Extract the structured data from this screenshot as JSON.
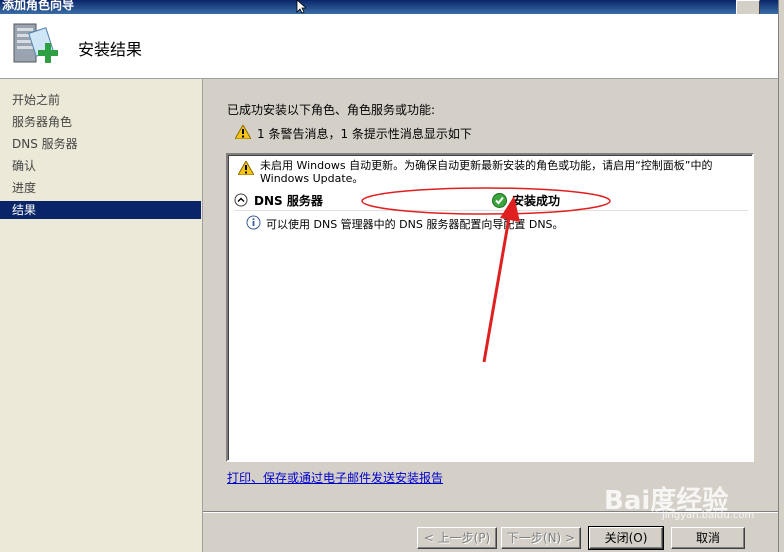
{
  "window": {
    "title": "添加角色向导"
  },
  "header": {
    "title": "安装结果"
  },
  "nav": {
    "items": [
      {
        "label": "开始之前",
        "active": false
      },
      {
        "label": "服务器角色",
        "active": false
      },
      {
        "label": "DNS 服务器",
        "active": false
      },
      {
        "label": "确认",
        "active": false
      },
      {
        "label": "进度",
        "active": false
      },
      {
        "label": "结果",
        "active": true
      }
    ]
  },
  "content": {
    "summary": "已成功安装以下角色、角色服务或功能:",
    "warning_summary": "1 条警告消息，1 条提示性消息显示如下",
    "results": {
      "warning_message": "未启用 Windows 自动更新。为确保自动更新最新安装的角色或功能，请启用“控制面板”中的 Windows Update。",
      "role": {
        "name": "DNS 服务器",
        "status": "安装成功"
      },
      "info_message": "可以使用 DNS 管理器中的 DNS 服务器配置向导配置 DNS。"
    },
    "report_link": "打印、保存或通过电子邮件发送安装报告"
  },
  "buttons": {
    "prev": "< 上一步(P)",
    "next": "下一步(N) >",
    "close": "关闭(O)",
    "cancel": "取消"
  },
  "watermark": {
    "brand": "Bai度经验",
    "url": "jingyan.baidu.com"
  },
  "colors": {
    "annotation": "#e02020",
    "nav_active": "#0a246a",
    "link": "#0000cc"
  }
}
